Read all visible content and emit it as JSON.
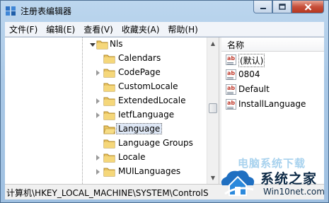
{
  "window": {
    "title": "注册表编辑器",
    "minimize_icon": "minimize-icon",
    "maximize_icon": "maximize-icon",
    "close_icon": "close-icon"
  },
  "menu": [
    {
      "label": "文件(F)"
    },
    {
      "label": "编辑(E)"
    },
    {
      "label": "查看(V)"
    },
    {
      "label": "收藏夹(A)"
    },
    {
      "label": "帮助(H)"
    }
  ],
  "tree": {
    "parent": {
      "label": "Nls",
      "state": "expanded"
    },
    "children": [
      {
        "label": "Calendars",
        "expander": "none"
      },
      {
        "label": "CodePage",
        "expander": "collapsed"
      },
      {
        "label": "CustomLocale",
        "expander": "none"
      },
      {
        "label": "ExtendedLocale",
        "expander": "collapsed"
      },
      {
        "label": "IetfLanguage",
        "expander": "collapsed"
      },
      {
        "label": "Language",
        "expander": "none",
        "selected": true
      },
      {
        "label": "Language Groups",
        "expander": "none"
      },
      {
        "label": "Locale",
        "expander": "collapsed"
      },
      {
        "label": "MUILanguages",
        "expander": "collapsed"
      }
    ]
  },
  "values": {
    "column_header": "名称",
    "items": [
      {
        "name": "(默认)",
        "icon": "string-value-icon"
      },
      {
        "name": "0804",
        "icon": "string-value-icon"
      },
      {
        "name": "Default",
        "icon": "string-value-icon"
      },
      {
        "name": "InstallLanguage",
        "icon": "string-value-icon"
      }
    ]
  },
  "status": {
    "path": "计算机\\HKEY_LOCAL_MACHINE\\SYSTEM\\ControlS"
  },
  "watermark": {
    "faint_text": "电脑系统下载",
    "main_text": "系统之家",
    "sub_text": "Win10net.com"
  },
  "colors": {
    "frame": "#a9c8e6",
    "selection": "#dfe8f6",
    "close_button": "#c7503b"
  }
}
